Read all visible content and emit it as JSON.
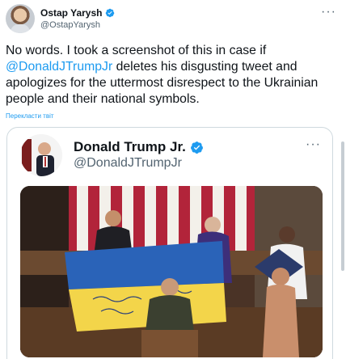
{
  "tweet": {
    "author_name": "Ostap Yarysh",
    "author_handle": "@OstapYarysh",
    "text_before": "No words. I took a screenshot of this in case if ",
    "mention": "@DonaldJTrumpJr",
    "text_after": " deletes his disgusting tweet and apologizes for the uttermost disrespect to the Ukrainian people and their national symbols.",
    "translate_label": "Перекласти твіт"
  },
  "quoted": {
    "author_name": "Donald Trump Jr.",
    "author_handle": "@DonaldJTrumpJr"
  },
  "icons": {
    "verified": "verified-badge-icon",
    "more": "more-options-icon"
  },
  "colors": {
    "accent": "#1d9bf0",
    "secondary_text": "#536471",
    "flag_blue": "#2a63b8",
    "flag_yellow": "#f3d54a"
  }
}
